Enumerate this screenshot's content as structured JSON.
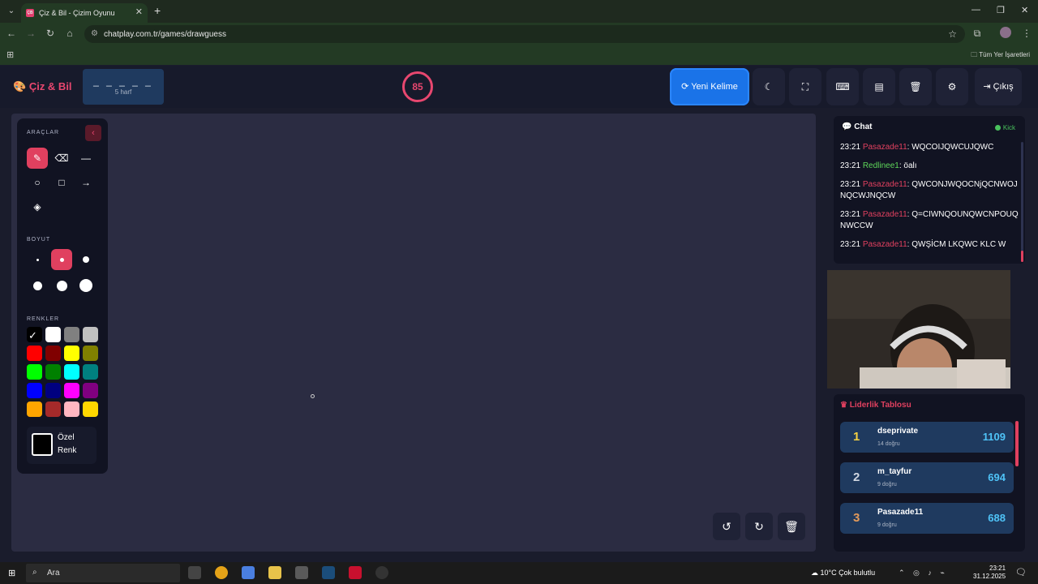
{
  "browser": {
    "tab_title": "Çiz & Bil - Çizim Oyunu",
    "tab_favicon_text": "ÇB",
    "url": "chatplay.com.tr/games/drawguess",
    "bookmarks_all": "Tüm Yer İşaretleri"
  },
  "header": {
    "logo": "Çiz & Bil",
    "word_mask": "_ _ _ _ _",
    "word_hint": "5 harf",
    "timer": "85",
    "new_word_label": "Yeni Kelime",
    "exit_label": "Çıkış"
  },
  "tools": {
    "section_tools": "ARAÇLAR",
    "section_size": "BOYUT",
    "section_colors": "RENKLER",
    "custom_color_label": "Özel Renk",
    "colors": [
      "#000000",
      "#ffffff",
      "#808080",
      "#c0c0c0",
      "#ff0000",
      "#800000",
      "#ffff00",
      "#808000",
      "#00ff00",
      "#008000",
      "#00ffff",
      "#008080",
      "#0000ff",
      "#000080",
      "#ff00ff",
      "#800080",
      "#ffa500",
      "#a52a2a",
      "#ffb6c1",
      "#ffd700"
    ]
  },
  "chat": {
    "title": "Chat",
    "status": "Kick",
    "messages": [
      {
        "time": "23:21",
        "user": "Pasazade11",
        "text": ": WQCOIJQWCUJQWC",
        "color": "red"
      },
      {
        "time": "23:21",
        "user": "Redlinee1",
        "text": ": öalı",
        "color": "green"
      },
      {
        "time": "23:21",
        "user": "Pasazade11",
        "text": ": QWCONJWQOCNjQCNWOJNQCWJNQCW",
        "color": "red"
      },
      {
        "time": "23:21",
        "user": "Pasazade11",
        "text": ": Q=CIWNQOUNQWCNPOUQNWCCW",
        "color": "red"
      },
      {
        "time": "23:21",
        "user": "Pasazade11",
        "text": ": QWŞİCM LKQWC KLC W",
        "color": "red"
      }
    ]
  },
  "leaderboard": {
    "title": "Liderlik Tablosu",
    "rows": [
      {
        "rank": "1",
        "name": "dseprivate",
        "sub": "14 doğru",
        "score": "1109",
        "rank_color": "#f5d142"
      },
      {
        "rank": "2",
        "name": "m_tayfur",
        "sub": "9 doğru",
        "score": "694",
        "rank_color": "#cfd6e0"
      },
      {
        "rank": "3",
        "name": "Pasazade11",
        "sub": "9 doğru",
        "score": "688",
        "rank_color": "#e39a5a"
      }
    ]
  },
  "taskbar": {
    "search": "Ara",
    "weather": "10°C  Çok bulutlu",
    "time": "23:21",
    "date": "31.12.2025"
  }
}
